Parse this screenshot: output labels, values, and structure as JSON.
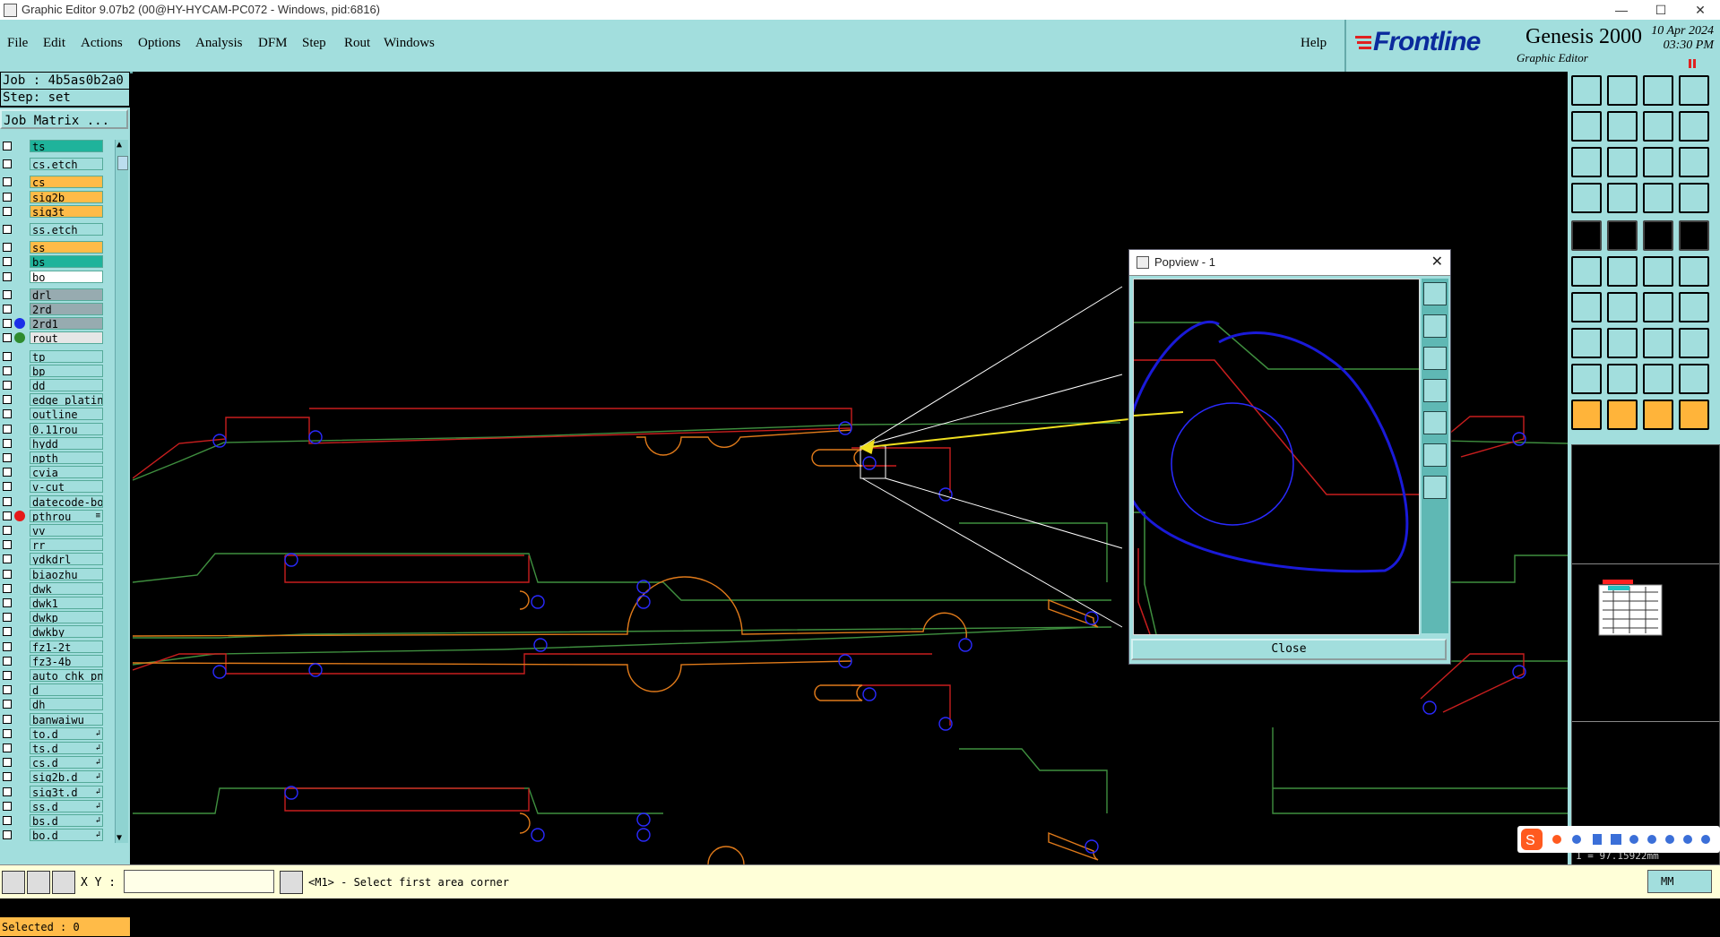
{
  "window": {
    "title": "Graphic Editor 9.07b2 (00@HY-HYCAM-PC072 - Windows, pid:6816)"
  },
  "menu": [
    {
      "label": "File"
    },
    {
      "label": "Edit"
    },
    {
      "label": "Actions"
    },
    {
      "label": "Options"
    },
    {
      "label": "Analysis"
    },
    {
      "label": "DFM"
    },
    {
      "label": "Step"
    },
    {
      "label": "Rout"
    },
    {
      "label": "Windows"
    }
  ],
  "help": "Help",
  "brand": {
    "logo": "Frontline",
    "product": "Genesis 2000",
    "subtitle": "Graphic Editor",
    "date": "10 Apr 2024",
    "time": "03:30 PM"
  },
  "job": {
    "job_line": "Job : 4b5as0b2a0",
    "step_line": "Step: set",
    "matrix_button": "Job Matrix ..."
  },
  "layers": [
    {
      "name": "ts",
      "color": "#1fb39b",
      "dot": ""
    },
    {
      "name": "cs.etch",
      "color": "#a2dedd",
      "dot": ""
    },
    {
      "name": "cs",
      "color": "#ffbb48",
      "dot": ""
    },
    {
      "name": "sig2b",
      "color": "#ffbb48",
      "dot": ""
    },
    {
      "name": "sig3t",
      "color": "#ffbb48",
      "dot": ""
    },
    {
      "name": "ss.etch",
      "color": "#a2dedd",
      "dot": ""
    },
    {
      "name": "ss",
      "color": "#ffbb48",
      "dot": ""
    },
    {
      "name": "bs",
      "color": "#1fb39b",
      "dot": ""
    },
    {
      "name": "bo",
      "color": "#ffffff",
      "dot": ""
    },
    {
      "name": "drl",
      "color": "#97abb0",
      "dot": ""
    },
    {
      "name": "2rd",
      "color": "#97abb0",
      "dot": ""
    },
    {
      "name": "2rd1",
      "color": "#97abb0",
      "dot": "#1a2fe8"
    },
    {
      "name": "rout",
      "color": "#e6e6e6",
      "dot": "#2e8b2e"
    },
    {
      "name": "tp",
      "color": "#a2dedd",
      "dot": ""
    },
    {
      "name": "bp",
      "color": "#a2dedd",
      "dot": ""
    },
    {
      "name": "dd",
      "color": "#a2dedd",
      "dot": ""
    },
    {
      "name": "edge_plating",
      "color": "#a2dedd",
      "dot": ""
    },
    {
      "name": "outline",
      "color": "#a2dedd",
      "dot": ""
    },
    {
      "name": "0.11rou",
      "color": "#a2dedd",
      "dot": ""
    },
    {
      "name": "hydd",
      "color": "#a2dedd",
      "dot": ""
    },
    {
      "name": "npth",
      "color": "#a2dedd",
      "dot": ""
    },
    {
      "name": "cvia",
      "color": "#a2dedd",
      "dot": ""
    },
    {
      "name": "v-cut",
      "color": "#a2dedd",
      "dot": ""
    },
    {
      "name": "datecode-bo",
      "color": "#a2dedd",
      "dot": ""
    },
    {
      "name": "pthrou",
      "color": "#a2dedd",
      "dot": "#e51a1a",
      "mark": "≡"
    },
    {
      "name": "vv",
      "color": "#a2dedd",
      "dot": ""
    },
    {
      "name": "rr",
      "color": "#a2dedd",
      "dot": ""
    },
    {
      "name": "ydkdrl",
      "color": "#a2dedd",
      "dot": ""
    },
    {
      "name": "biaozhu",
      "color": "#a2dedd",
      "dot": ""
    },
    {
      "name": "dwk",
      "color": "#a2dedd",
      "dot": ""
    },
    {
      "name": "dwk1",
      "color": "#a2dedd",
      "dot": ""
    },
    {
      "name": "dwkp",
      "color": "#a2dedd",
      "dot": ""
    },
    {
      "name": "dwkby",
      "color": "#a2dedd",
      "dot": ""
    },
    {
      "name": "fz1-2t",
      "color": "#a2dedd",
      "dot": ""
    },
    {
      "name": "fz3-4b",
      "color": "#a2dedd",
      "dot": ""
    },
    {
      "name": "auto_chk_pn",
      "color": "#a2dedd",
      "dot": ""
    },
    {
      "name": "d",
      "color": "#a2dedd",
      "dot": ""
    },
    {
      "name": "dh",
      "color": "#a2dedd",
      "dot": ""
    },
    {
      "name": "banwaiwu",
      "color": "#a2dedd",
      "dot": ""
    },
    {
      "name": "to.d",
      "color": "#a2dedd",
      "dot": "",
      "mark": "↲"
    },
    {
      "name": "ts.d",
      "color": "#a2dedd",
      "dot": "",
      "mark": "↲"
    },
    {
      "name": "cs.d",
      "color": "#a2dedd",
      "dot": "",
      "mark": "↲"
    },
    {
      "name": "sig2b.d",
      "color": "#a2dedd",
      "dot": "",
      "mark": "↲"
    },
    {
      "name": "sig3t.d",
      "color": "#a2dedd",
      "dot": "",
      "mark": "↲"
    },
    {
      "name": "ss.d",
      "color": "#a2dedd",
      "dot": "",
      "mark": "↲"
    },
    {
      "name": "bs.d",
      "color": "#a2dedd",
      "dot": "",
      "mark": "↲"
    },
    {
      "name": "bo.d",
      "color": "#a2dedd",
      "dot": "",
      "mark": "↲"
    }
  ],
  "selected": "Selected : 0",
  "popview": {
    "title": "Popview - 1",
    "close_button": "Close"
  },
  "status": {
    "xy_label": "X Y :",
    "xy_value": "",
    "message": "<M1> - Select first area corner",
    "units": "MM"
  },
  "minimap": {
    "coord_text": "1 = 97.15922mm"
  }
}
